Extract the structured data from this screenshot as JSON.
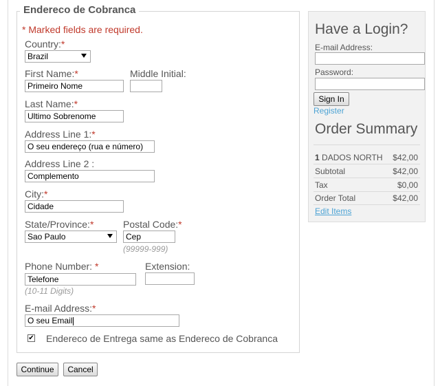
{
  "billing": {
    "legend": "Endereco de Cobranca",
    "required_note": "* Marked fields are required.",
    "country": {
      "label": "Country:",
      "value": "Brazil"
    },
    "first_name": {
      "label": "First Name:",
      "value": "Primeiro Nome"
    },
    "middle_initial": {
      "label": "Middle Initial:",
      "value": ""
    },
    "last_name": {
      "label": "Last Name:",
      "value": "Ultimo Sobrenome"
    },
    "address1": {
      "label": "Address Line 1:",
      "value": "O seu endereço (rua e número)"
    },
    "address2": {
      "label": "Address Line 2 :",
      "value": "Complemento"
    },
    "city": {
      "label": "City:",
      "value": "Cidade"
    },
    "state": {
      "label": "State/Province:",
      "value": "Sao Paulo"
    },
    "postal": {
      "label": "Postal Code:",
      "value": "Cep",
      "hint": "(99999-999)"
    },
    "phone": {
      "label": "Phone Number: ",
      "value": "Telefone",
      "hint": "(10-11 Digits)"
    },
    "extension": {
      "label": "Extension:",
      "value": ""
    },
    "email": {
      "label": "E-mail Address:",
      "value": "O seu Email"
    },
    "required_marker": "*",
    "same_address": {
      "label": "Endereco de Entrega same as Endereco de Cobranca",
      "checked": true
    }
  },
  "actions": {
    "continue_label": "Continue",
    "cancel_label": "Cancel"
  },
  "login": {
    "title": "Have a Login?",
    "email_label": "E-mail Address:",
    "password_label": "Password:",
    "signin_label": "Sign In",
    "register_label": "Register"
  },
  "order": {
    "title": "Order Summary",
    "item": {
      "qty": "1",
      "name": "DADOS NORTH",
      "price": "$42,00"
    },
    "subtotal": {
      "label": "Subtotal",
      "value": "$42,00"
    },
    "tax": {
      "label": "Tax",
      "value": "$0,00"
    },
    "total": {
      "label": "Order Total",
      "value": "$42,00"
    },
    "edit_label": "Edit Items"
  },
  "icons": {
    "checkbox_check": "✔"
  },
  "colors": {
    "required": "#c0392b",
    "link": "#4da3d4",
    "panel_bg": "#f2f2f2"
  }
}
